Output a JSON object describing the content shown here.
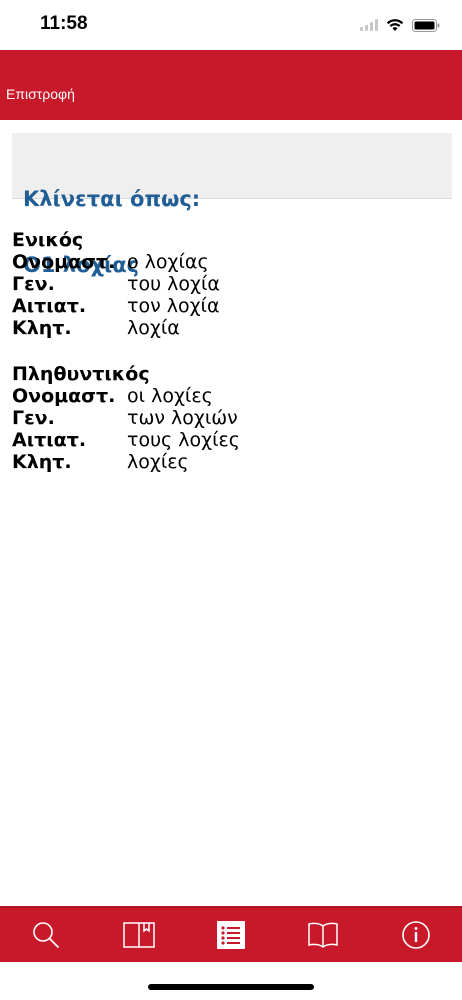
{
  "status_bar": {
    "time": "11:58"
  },
  "nav": {
    "back_label": "Επιστροφή"
  },
  "header": {
    "line1": "Κλίνεται όπως:",
    "line2": "O1 λοχίας"
  },
  "singular": {
    "title": "Ενικός",
    "rows": [
      {
        "label": "Ονομαστ.",
        "value": "ο λοχίας"
      },
      {
        "label": "Γεν.",
        "value": "του λοχία"
      },
      {
        "label": "Αιτιατ.",
        "value": "τον λοχία"
      },
      {
        "label": "Κλητ.",
        "value": "λοχία"
      }
    ]
  },
  "plural": {
    "title": "Πληθυντικός",
    "rows": [
      {
        "label": "Ονομαστ.",
        "value": "οι λοχίες"
      },
      {
        "label": "Γεν.",
        "value": "των λοχιών"
      },
      {
        "label": "Αιτιατ.",
        "value": "τους λοχίες"
      },
      {
        "label": "Κλητ.",
        "value": "λοχίες"
      }
    ]
  },
  "tab_bar": {
    "icons": [
      "search-icon",
      "bookmark-book-icon",
      "list-icon",
      "open-book-icon",
      "info-icon"
    ],
    "accent": "#c8192a"
  }
}
